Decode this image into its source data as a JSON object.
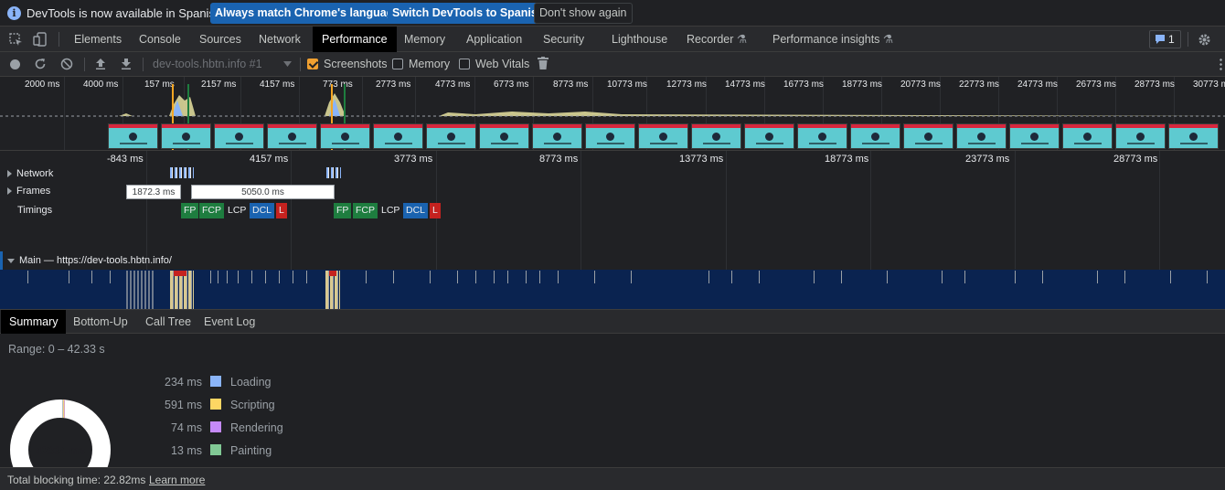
{
  "infobar": {
    "message": "DevTools is now available in Spanish!",
    "match_button": "Always match Chrome's language",
    "switch_button": "Switch DevTools to Spanish",
    "dismiss_button": "Don't show again"
  },
  "tabs": {
    "items": [
      "Elements",
      "Console",
      "Sources",
      "Network",
      "Performance",
      "Memory",
      "Application",
      "Security",
      "Lighthouse",
      "Recorder",
      "Performance insights"
    ],
    "active": "Performance",
    "issues_count": "1",
    "experimental_glyph": "⚗"
  },
  "toolbar": {
    "profile_select": "dev-tools.hbtn.info #1",
    "screenshots_label": "Screenshots",
    "screenshots_checked": true,
    "memory_label": "Memory",
    "memory_checked": false,
    "webvitals_label": "Web Vitals",
    "webvitals_checked": false
  },
  "overview": {
    "ticks": [
      "2000 ms",
      "4000 ms",
      "157 ms",
      "2157 ms",
      "4157 ms",
      "773 ms",
      "2773 ms",
      "4773 ms",
      "6773 ms",
      "8773 ms",
      "10773 ms",
      "12773 ms",
      "14773 ms",
      "16773 ms",
      "18773 ms",
      "20773 ms",
      "22773 ms",
      "24773 ms",
      "26773 ms",
      "28773 ms",
      "30773 ms"
    ],
    "screenshot_count": 21
  },
  "timeline": {
    "ticks": [
      "-843 ms",
      "4157 ms",
      "3773 ms",
      "8773 ms",
      "13773 ms",
      "18773 ms",
      "23773 ms",
      "28773 ms"
    ],
    "tracks": {
      "network": "Network",
      "frames": "Frames",
      "timings": "Timings",
      "main": "Main — https://dev-tools.hbtn.info/"
    },
    "frame_boxes": [
      "1872.3 ms",
      "5050.0 ms"
    ],
    "timing_marks_1": [
      "FP",
      "FCP",
      "LCP",
      "DCL",
      "L"
    ],
    "timing_marks_2": [
      "FP",
      "FCP",
      "LCP",
      "DCL",
      "L"
    ],
    "colors": {
      "fp": "#1e7d3f",
      "dcl": "#1a63b0",
      "load": "#c5221f",
      "main_bg": "#0a2350"
    }
  },
  "bottom_tabs": {
    "items": [
      "Summary",
      "Bottom-Up",
      "Call Tree",
      "Event Log"
    ],
    "active": "Summary"
  },
  "summary": {
    "range": "Range: 0 – 42.33 s",
    "total": "42334 ms",
    "legend": [
      {
        "ms": "234 ms",
        "label": "Loading",
        "color": "#8ab4f8"
      },
      {
        "ms": "591 ms",
        "label": "Scripting",
        "color": "#fdd663"
      },
      {
        "ms": "74 ms",
        "label": "Rendering",
        "color": "#c58af9"
      },
      {
        "ms": "13 ms",
        "label": "Painting",
        "color": "#81c995"
      }
    ]
  },
  "footer": {
    "tbt": "Total blocking time: 22.82ms",
    "learn_more": "Learn more"
  }
}
